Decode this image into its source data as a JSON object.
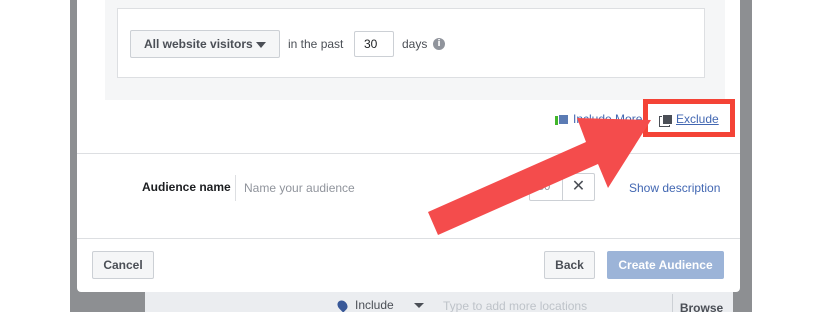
{
  "background_form": {
    "include_label": "Include",
    "locations_placeholder": "Type to add more locations",
    "browse_label": "Browse"
  },
  "rule": {
    "visitor_select": "All website visitors",
    "past_label": "in the past",
    "days_value": "30",
    "days_label": "days",
    "info_icon": "info-icon"
  },
  "links": {
    "include_more": "Include More",
    "exclude": "Exclude"
  },
  "audience": {
    "label": "Audience name",
    "name_placeholder": "Name your audience",
    "char_count": "50",
    "clear_icon": "close-icon",
    "show_description": "Show description"
  },
  "footer": {
    "cancel": "Cancel",
    "back": "Back",
    "create": "Create Audience"
  },
  "annotation": {
    "highlight_color": "#f44336",
    "arrow_color": "#f44c4c"
  }
}
